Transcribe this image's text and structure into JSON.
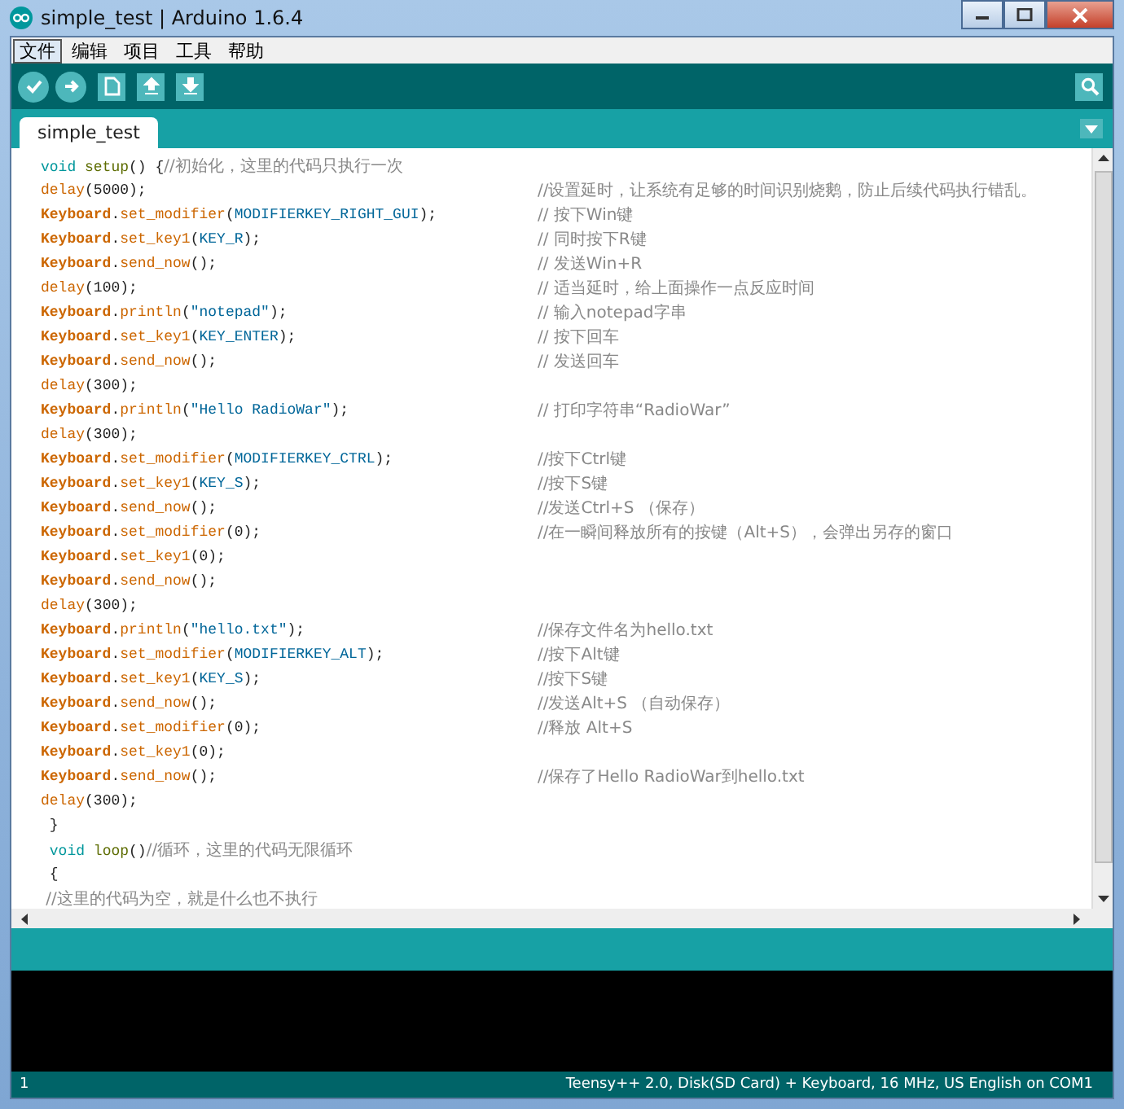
{
  "window": {
    "title": "simple_test | Arduino 1.6.4"
  },
  "menu": [
    {
      "label": "文件",
      "selected": true
    },
    {
      "label": "编辑",
      "selected": false
    },
    {
      "label": "项目",
      "selected": false
    },
    {
      "label": "工具",
      "selected": false
    },
    {
      "label": "帮助",
      "selected": false
    }
  ],
  "tabs": [
    {
      "label": "simple_test",
      "selected": true
    }
  ],
  "editor": {
    "lines": [
      {
        "code": [
          {
            "text": "void",
            "kind": "keyword"
          },
          {
            "text": " setup",
            "kind": "function"
          },
          {
            "text": "() {",
            "kind": "plain"
          },
          {
            "text": "//初始化，这里的代码只执行一次",
            "kind": "comment"
          }
        ]
      },
      {
        "code": [
          {
            "text": "delay",
            "kind": "call"
          },
          {
            "text": "(5000);",
            "kind": "plain"
          }
        ],
        "comment": "//设置延时，让系统有足够的时间识别烧鹅，防止后续代码执行错乱。"
      },
      {
        "code": [
          {
            "text": "Keyboard",
            "kind": "library"
          },
          {
            "text": ".",
            "kind": "plain"
          },
          {
            "text": "set_modifier",
            "kind": "method"
          },
          {
            "text": "(",
            "kind": "plain"
          },
          {
            "text": "MODIFIERKEY_RIGHT_GUI",
            "kind": "constant"
          },
          {
            "text": ");",
            "kind": "plain"
          }
        ],
        "comment": "// 按下Win键"
      },
      {
        "code": [
          {
            "text": "Keyboard",
            "kind": "library"
          },
          {
            "text": ".",
            "kind": "plain"
          },
          {
            "text": "set_key1",
            "kind": "method"
          },
          {
            "text": "(",
            "kind": "plain"
          },
          {
            "text": "KEY_R",
            "kind": "constant"
          },
          {
            "text": ");",
            "kind": "plain"
          }
        ],
        "comment": "// 同时按下R键"
      },
      {
        "code": [
          {
            "text": "Keyboard",
            "kind": "library"
          },
          {
            "text": ".",
            "kind": "plain"
          },
          {
            "text": "send_now",
            "kind": "method"
          },
          {
            "text": "();",
            "kind": "plain"
          }
        ],
        "comment": "// 发送Win+R"
      },
      {
        "code": [
          {
            "text": "delay",
            "kind": "call"
          },
          {
            "text": "(100);",
            "kind": "plain"
          }
        ],
        "comment": "// 适当延时，给上面操作一点反应时间"
      },
      {
        "code": [
          {
            "text": "Keyboard",
            "kind": "library"
          },
          {
            "text": ".",
            "kind": "plain"
          },
          {
            "text": "println",
            "kind": "method"
          },
          {
            "text": "(",
            "kind": "plain"
          },
          {
            "text": "\"notepad\"",
            "kind": "string"
          },
          {
            "text": ");",
            "kind": "plain"
          }
        ],
        "comment": "// 输入notepad字串"
      },
      {
        "code": [
          {
            "text": "Keyboard",
            "kind": "library"
          },
          {
            "text": ".",
            "kind": "plain"
          },
          {
            "text": "set_key1",
            "kind": "method"
          },
          {
            "text": "(",
            "kind": "plain"
          },
          {
            "text": "KEY_ENTER",
            "kind": "constant"
          },
          {
            "text": ");",
            "kind": "plain"
          }
        ],
        "comment": "// 按下回车"
      },
      {
        "code": [
          {
            "text": "Keyboard",
            "kind": "library"
          },
          {
            "text": ".",
            "kind": "plain"
          },
          {
            "text": "send_now",
            "kind": "method"
          },
          {
            "text": "();",
            "kind": "plain"
          }
        ],
        "comment": "// 发送回车"
      },
      {
        "code": [
          {
            "text": "delay",
            "kind": "call"
          },
          {
            "text": "(300);",
            "kind": "plain"
          }
        ]
      },
      {
        "code": [
          {
            "text": "Keyboard",
            "kind": "library"
          },
          {
            "text": ".",
            "kind": "plain"
          },
          {
            "text": "println",
            "kind": "method"
          },
          {
            "text": "(",
            "kind": "plain"
          },
          {
            "text": "\"Hello RadioWar\"",
            "kind": "string"
          },
          {
            "text": ");",
            "kind": "plain"
          }
        ],
        "comment": "// 打印字符串“RadioWar”"
      },
      {
        "code": [
          {
            "text": "delay",
            "kind": "call"
          },
          {
            "text": "(300);",
            "kind": "plain"
          }
        ]
      },
      {
        "code": [
          {
            "text": "Keyboard",
            "kind": "library"
          },
          {
            "text": ".",
            "kind": "plain"
          },
          {
            "text": "set_modifier",
            "kind": "method"
          },
          {
            "text": "(",
            "kind": "plain"
          },
          {
            "text": "MODIFIERKEY_CTRL",
            "kind": "constant"
          },
          {
            "text": ");",
            "kind": "plain"
          }
        ],
        "comment": "//按下Ctrl键"
      },
      {
        "code": [
          {
            "text": "Keyboard",
            "kind": "library"
          },
          {
            "text": ".",
            "kind": "plain"
          },
          {
            "text": "set_key1",
            "kind": "method"
          },
          {
            "text": "(",
            "kind": "plain"
          },
          {
            "text": "KEY_S",
            "kind": "constant"
          },
          {
            "text": ");",
            "kind": "plain"
          }
        ],
        "comment": "//按下S键"
      },
      {
        "code": [
          {
            "text": "Keyboard",
            "kind": "library"
          },
          {
            "text": ".",
            "kind": "plain"
          },
          {
            "text": "send_now",
            "kind": "method"
          },
          {
            "text": "();",
            "kind": "plain"
          }
        ],
        "comment": "//发送Ctrl+S （保存）"
      },
      {
        "code": [
          {
            "text": "Keyboard",
            "kind": "library"
          },
          {
            "text": ".",
            "kind": "plain"
          },
          {
            "text": "set_modifier",
            "kind": "method"
          },
          {
            "text": "(0);",
            "kind": "plain"
          }
        ],
        "comment": "//在一瞬间释放所有的按键（Alt+S），会弹出另存的窗口"
      },
      {
        "code": [
          {
            "text": "Keyboard",
            "kind": "library"
          },
          {
            "text": ".",
            "kind": "plain"
          },
          {
            "text": "set_key1",
            "kind": "method"
          },
          {
            "text": "(0);",
            "kind": "plain"
          }
        ]
      },
      {
        "code": [
          {
            "text": "Keyboard",
            "kind": "library"
          },
          {
            "text": ".",
            "kind": "plain"
          },
          {
            "text": "send_now",
            "kind": "method"
          },
          {
            "text": "();",
            "kind": "plain"
          }
        ]
      },
      {
        "code": [
          {
            "text": "delay",
            "kind": "call"
          },
          {
            "text": "(300);",
            "kind": "plain"
          }
        ]
      },
      {
        "code": [
          {
            "text": "Keyboard",
            "kind": "library"
          },
          {
            "text": ".",
            "kind": "plain"
          },
          {
            "text": "println",
            "kind": "method"
          },
          {
            "text": "(",
            "kind": "plain"
          },
          {
            "text": "\"hello.txt\"",
            "kind": "string"
          },
          {
            "text": ");",
            "kind": "plain"
          }
        ],
        "comment": "//保存文件名为hello.txt"
      },
      {
        "code": [
          {
            "text": "Keyboard",
            "kind": "library"
          },
          {
            "text": ".",
            "kind": "plain"
          },
          {
            "text": "set_modifier",
            "kind": "method"
          },
          {
            "text": "(",
            "kind": "plain"
          },
          {
            "text": "MODIFIERKEY_ALT",
            "kind": "constant"
          },
          {
            "text": ");",
            "kind": "plain"
          }
        ],
        "comment": "//按下Alt键"
      },
      {
        "code": [
          {
            "text": "Keyboard",
            "kind": "library"
          },
          {
            "text": ".",
            "kind": "plain"
          },
          {
            "text": "set_key1",
            "kind": "method"
          },
          {
            "text": "(",
            "kind": "plain"
          },
          {
            "text": "KEY_S",
            "kind": "constant"
          },
          {
            "text": ");",
            "kind": "plain"
          }
        ],
        "comment": "//按下S键"
      },
      {
        "code": [
          {
            "text": "Keyboard",
            "kind": "library"
          },
          {
            "text": ".",
            "kind": "plain"
          },
          {
            "text": "send_now",
            "kind": "method"
          },
          {
            "text": "();",
            "kind": "plain"
          }
        ],
        "comment": "//发送Alt+S （自动保存）"
      },
      {
        "code": [
          {
            "text": "Keyboard",
            "kind": "library"
          },
          {
            "text": ".",
            "kind": "plain"
          },
          {
            "text": "set_modifier",
            "kind": "method"
          },
          {
            "text": "(0);",
            "kind": "plain"
          }
        ],
        "comment": "//释放 Alt+S"
      },
      {
        "code": [
          {
            "text": "Keyboard",
            "kind": "library"
          },
          {
            "text": ".",
            "kind": "plain"
          },
          {
            "text": "set_key1",
            "kind": "method"
          },
          {
            "text": "(0);",
            "kind": "plain"
          }
        ]
      },
      {
        "code": [
          {
            "text": "Keyboard",
            "kind": "library"
          },
          {
            "text": ".",
            "kind": "plain"
          },
          {
            "text": "send_now",
            "kind": "method"
          },
          {
            "text": "();",
            "kind": "plain"
          }
        ],
        "comment": "//保存了Hello RadioWar到hello.txt"
      },
      {
        "code": [
          {
            "text": "delay",
            "kind": "call"
          },
          {
            "text": "(300);",
            "kind": "plain"
          }
        ]
      },
      {
        "code": [
          {
            "text": " }",
            "kind": "plain"
          }
        ]
      },
      {
        "code": [
          {
            "text": " void",
            "kind": "keyword"
          },
          {
            "text": " loop",
            "kind": "function"
          },
          {
            "text": "()",
            "kind": "plain"
          },
          {
            "text": "//循环，这里的代码无限循环",
            "kind": "comment"
          }
        ]
      },
      {
        "code": [
          {
            "text": " {",
            "kind": "plain"
          }
        ]
      },
      {
        "code": [
          {
            "text": " //这里的代码为空，就是什么也不执行",
            "kind": "comment"
          }
        ]
      }
    ]
  },
  "status_bar": {
    "line": "1",
    "board": "Teensy++ 2.0, Disk(SD Card) + Keyboard, 16 MHz, US English on COM1"
  }
}
